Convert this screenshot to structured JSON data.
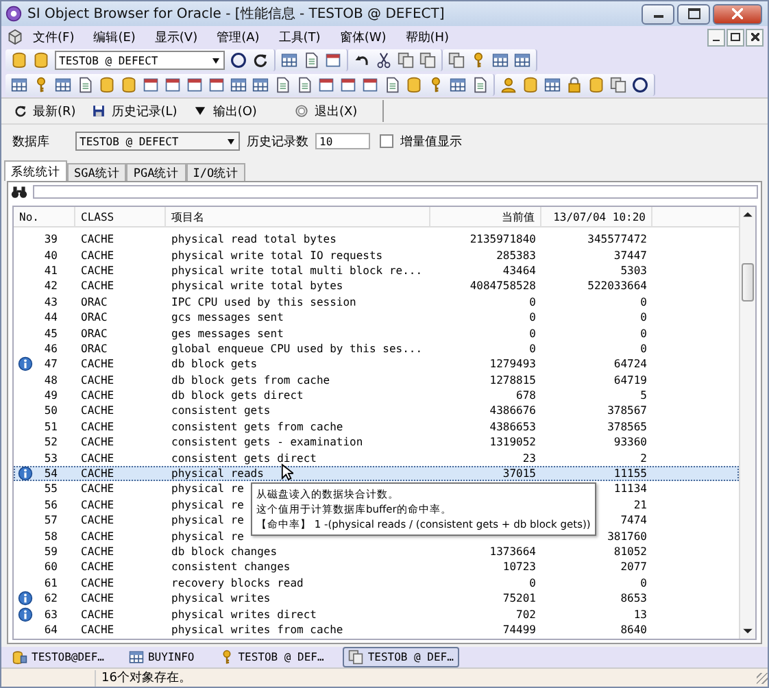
{
  "window": {
    "title": "SI Object Browser for Oracle - [性能信息 - TESTOB @ DEFECT]"
  },
  "menu": [
    "文件(F)",
    "编辑(E)",
    "显示(V)",
    "管理(A)",
    "工具(T)",
    "窗体(W)",
    "帮助(H)"
  ],
  "connection": {
    "value": "TESTOB @ DEFECT"
  },
  "actions": [
    {
      "label": "最新(R)",
      "kind": "refresh"
    },
    {
      "label": "历史记录(L)",
      "kind": "save"
    },
    {
      "label": "输出(O)",
      "kind": "dropdown"
    },
    {
      "label": "退出(X)",
      "kind": "exit"
    }
  ],
  "filter": {
    "db_label": "数据库",
    "db_value": "TESTOB @ DEFECT",
    "history_label": "历史记录数",
    "history_value": "10",
    "delta_label": "增量值显示",
    "delta_checked": false
  },
  "tabs": [
    {
      "label": "系统统计",
      "selected": true
    },
    {
      "label": "SGA统计",
      "selected": false
    },
    {
      "label": "PGA统计",
      "selected": false
    },
    {
      "label": "I/O统计",
      "selected": false
    }
  ],
  "table": {
    "columns": [
      "No.",
      "CLASS",
      "项目名",
      "当前值",
      "13/07/04 10:20"
    ],
    "rows": [
      {
        "no": "39",
        "class": "CACHE",
        "name": "physical read total bytes",
        "current": "2135971840",
        "prev": "345577472",
        "info": false,
        "selected": false
      },
      {
        "no": "40",
        "class": "CACHE",
        "name": "physical write total IO requests",
        "current": "285383",
        "prev": "37447",
        "info": false,
        "selected": false
      },
      {
        "no": "41",
        "class": "CACHE",
        "name": "physical write total multi block re...",
        "current": "43464",
        "prev": "5303",
        "info": false,
        "selected": false
      },
      {
        "no": "42",
        "class": "CACHE",
        "name": "physical write total bytes",
        "current": "4084758528",
        "prev": "522033664",
        "info": false,
        "selected": false
      },
      {
        "no": "43",
        "class": "ORAC",
        "name": "IPC CPU used by this session",
        "current": "0",
        "prev": "0",
        "info": false,
        "selected": false
      },
      {
        "no": "44",
        "class": "ORAC",
        "name": "gcs messages sent",
        "current": "0",
        "prev": "0",
        "info": false,
        "selected": false
      },
      {
        "no": "45",
        "class": "ORAC",
        "name": "ges messages sent",
        "current": "0",
        "prev": "0",
        "info": false,
        "selected": false
      },
      {
        "no": "46",
        "class": "ORAC",
        "name": "global enqueue CPU used by this ses...",
        "current": "0",
        "prev": "0",
        "info": false,
        "selected": false
      },
      {
        "no": "47",
        "class": "CACHE",
        "name": "db block gets",
        "current": "1279493",
        "prev": "64724",
        "info": true,
        "selected": false
      },
      {
        "no": "48",
        "class": "CACHE",
        "name": "db block gets from cache",
        "current": "1278815",
        "prev": "64719",
        "info": false,
        "selected": false
      },
      {
        "no": "49",
        "class": "CACHE",
        "name": "db block gets direct",
        "current": "678",
        "prev": "5",
        "info": false,
        "selected": false
      },
      {
        "no": "50",
        "class": "CACHE",
        "name": "consistent gets",
        "current": "4386676",
        "prev": "378567",
        "info": false,
        "selected": false
      },
      {
        "no": "51",
        "class": "CACHE",
        "name": "consistent gets from cache",
        "current": "4386653",
        "prev": "378565",
        "info": false,
        "selected": false
      },
      {
        "no": "52",
        "class": "CACHE",
        "name": "consistent gets - examination",
        "current": "1319052",
        "prev": "93360",
        "info": false,
        "selected": false
      },
      {
        "no": "53",
        "class": "CACHE",
        "name": "consistent gets direct",
        "current": "23",
        "prev": "2",
        "info": false,
        "selected": false
      },
      {
        "no": "54",
        "class": "CACHE",
        "name": "physical reads",
        "current": "37015",
        "prev": "11155",
        "info": true,
        "selected": true
      },
      {
        "no": "55",
        "class": "CACHE",
        "name": "physical re",
        "prev": "11134",
        "info": false,
        "selected": false
      },
      {
        "no": "56",
        "class": "CACHE",
        "name": "physical re",
        "prev": "21",
        "info": false,
        "selected": false
      },
      {
        "no": "57",
        "class": "CACHE",
        "name": "physical re",
        "prev": "7474",
        "info": false,
        "selected": false
      },
      {
        "no": "58",
        "class": "CACHE",
        "name": "physical re",
        "prev": "381760",
        "info": false,
        "selected": false
      },
      {
        "no": "59",
        "class": "CACHE",
        "name": "db block changes",
        "current": "1373664",
        "prev": "81052",
        "info": false,
        "selected": false
      },
      {
        "no": "60",
        "class": "CACHE",
        "name": "consistent changes",
        "current": "10723",
        "prev": "2077",
        "info": false,
        "selected": false
      },
      {
        "no": "61",
        "class": "CACHE",
        "name": "recovery blocks read",
        "current": "0",
        "prev": "0",
        "info": false,
        "selected": false
      },
      {
        "no": "62",
        "class": "CACHE",
        "name": "physical writes",
        "current": "75201",
        "prev": "8653",
        "info": true,
        "selected": false
      },
      {
        "no": "63",
        "class": "CACHE",
        "name": "physical writes direct",
        "current": "702",
        "prev": "13",
        "info": true,
        "selected": false
      },
      {
        "no": "64",
        "class": "CACHE",
        "name": "physical writes from cache",
        "current": "74499",
        "prev": "8640",
        "info": false,
        "selected": false
      }
    ]
  },
  "tooltip": {
    "lines": [
      "从磁盘读入的数据块合计数。",
      "这个值用于计算数据库buffer的命中率。",
      "【命中率】 1 -(physical reads / (consistent gets + db block gets))"
    ]
  },
  "taskbar": [
    {
      "label": "TESTOB@DEF…",
      "kind": "connection",
      "selected": false
    },
    {
      "label": "BUYINFO",
      "kind": "table",
      "selected": false
    },
    {
      "label": "TESTOB @ DEF…",
      "kind": "key",
      "selected": false
    },
    {
      "label": "TESTOB @ DEF…",
      "kind": "pages",
      "selected": true
    }
  ],
  "status_bar": {
    "text": "16个对象存在。"
  }
}
